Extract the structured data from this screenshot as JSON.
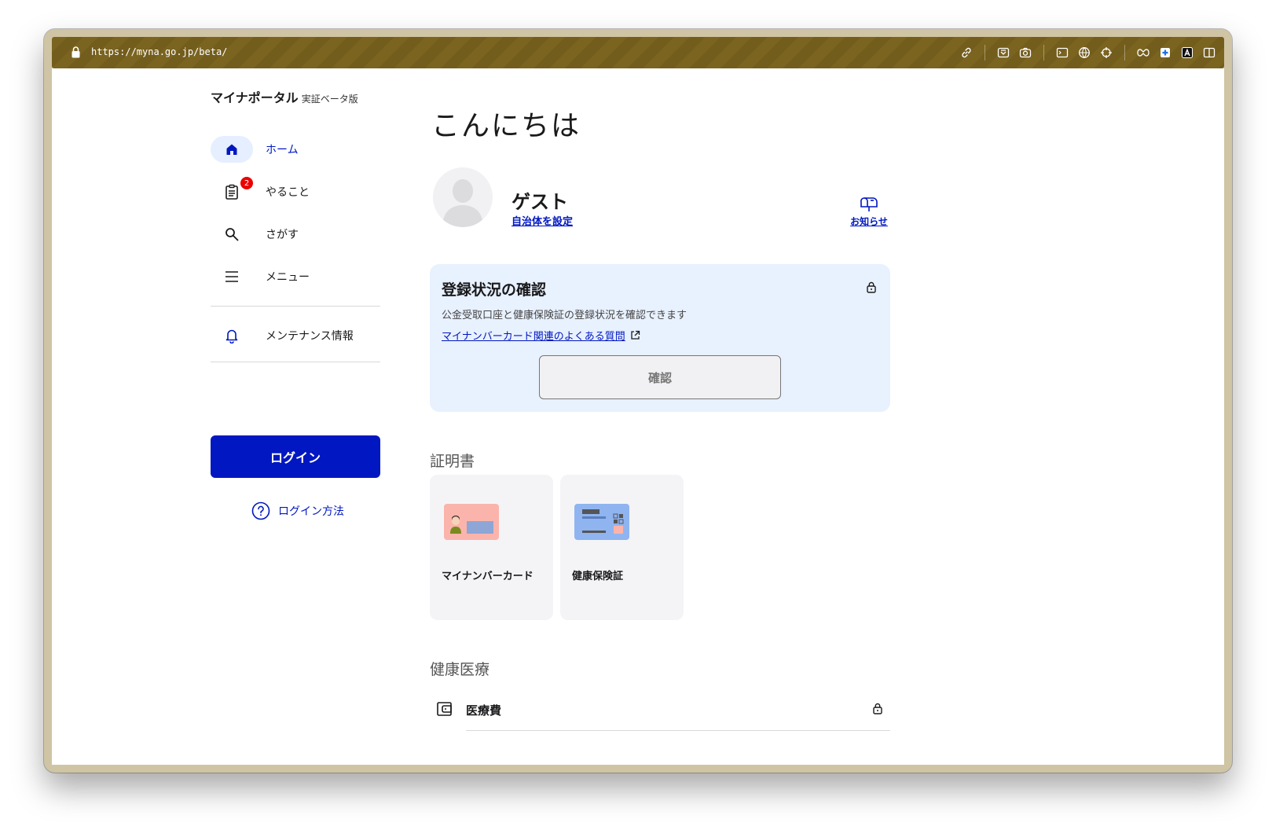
{
  "browser": {
    "url": "https://myna.go.jp/beta/",
    "icons": [
      "link-icon",
      "download-icon",
      "camera-icon",
      "terminal-icon",
      "globe-icon",
      "crosshair-icon",
      "extension-icon",
      "plus-icon",
      "a-icon",
      "sidebar-icon"
    ]
  },
  "sidebar": {
    "brand": "マイナポータル",
    "brand_sub": "実証ベータ版",
    "nav": [
      {
        "label": "ホーム",
        "icon": "home-icon",
        "active": true
      },
      {
        "label": "やること",
        "icon": "clipboard-icon",
        "badge": "2"
      },
      {
        "label": "さがす",
        "icon": "search-icon"
      },
      {
        "label": "メニュー",
        "icon": "menu-icon"
      }
    ],
    "maintenance": {
      "label": "メンテナンス情報",
      "icon": "bell-icon"
    },
    "login_button": "ログイン",
    "login_help": "ログイン方法"
  },
  "main": {
    "greeting": "こんにちは",
    "user": {
      "name": "ゲスト",
      "link": "自治体を設定"
    },
    "notice": "お知らせ",
    "registration": {
      "title": "登録状況の確認",
      "description": "公金受取口座と健康保険証の登録状況を確認できます",
      "link": "マイナンバーカード関連のよくある質問",
      "button": "確認"
    },
    "certificates": {
      "title": "証明書",
      "items": [
        {
          "label": "マイナンバーカード"
        },
        {
          "label": "健康保険証"
        }
      ]
    },
    "health": {
      "title": "健康医療",
      "items": [
        {
          "label": "医療費"
        }
      ]
    }
  },
  "colors": {
    "accent": "#0017c1",
    "card_bg": "#e8f1fe",
    "badge": "#ec0000",
    "toolbar": "#7a6420"
  }
}
